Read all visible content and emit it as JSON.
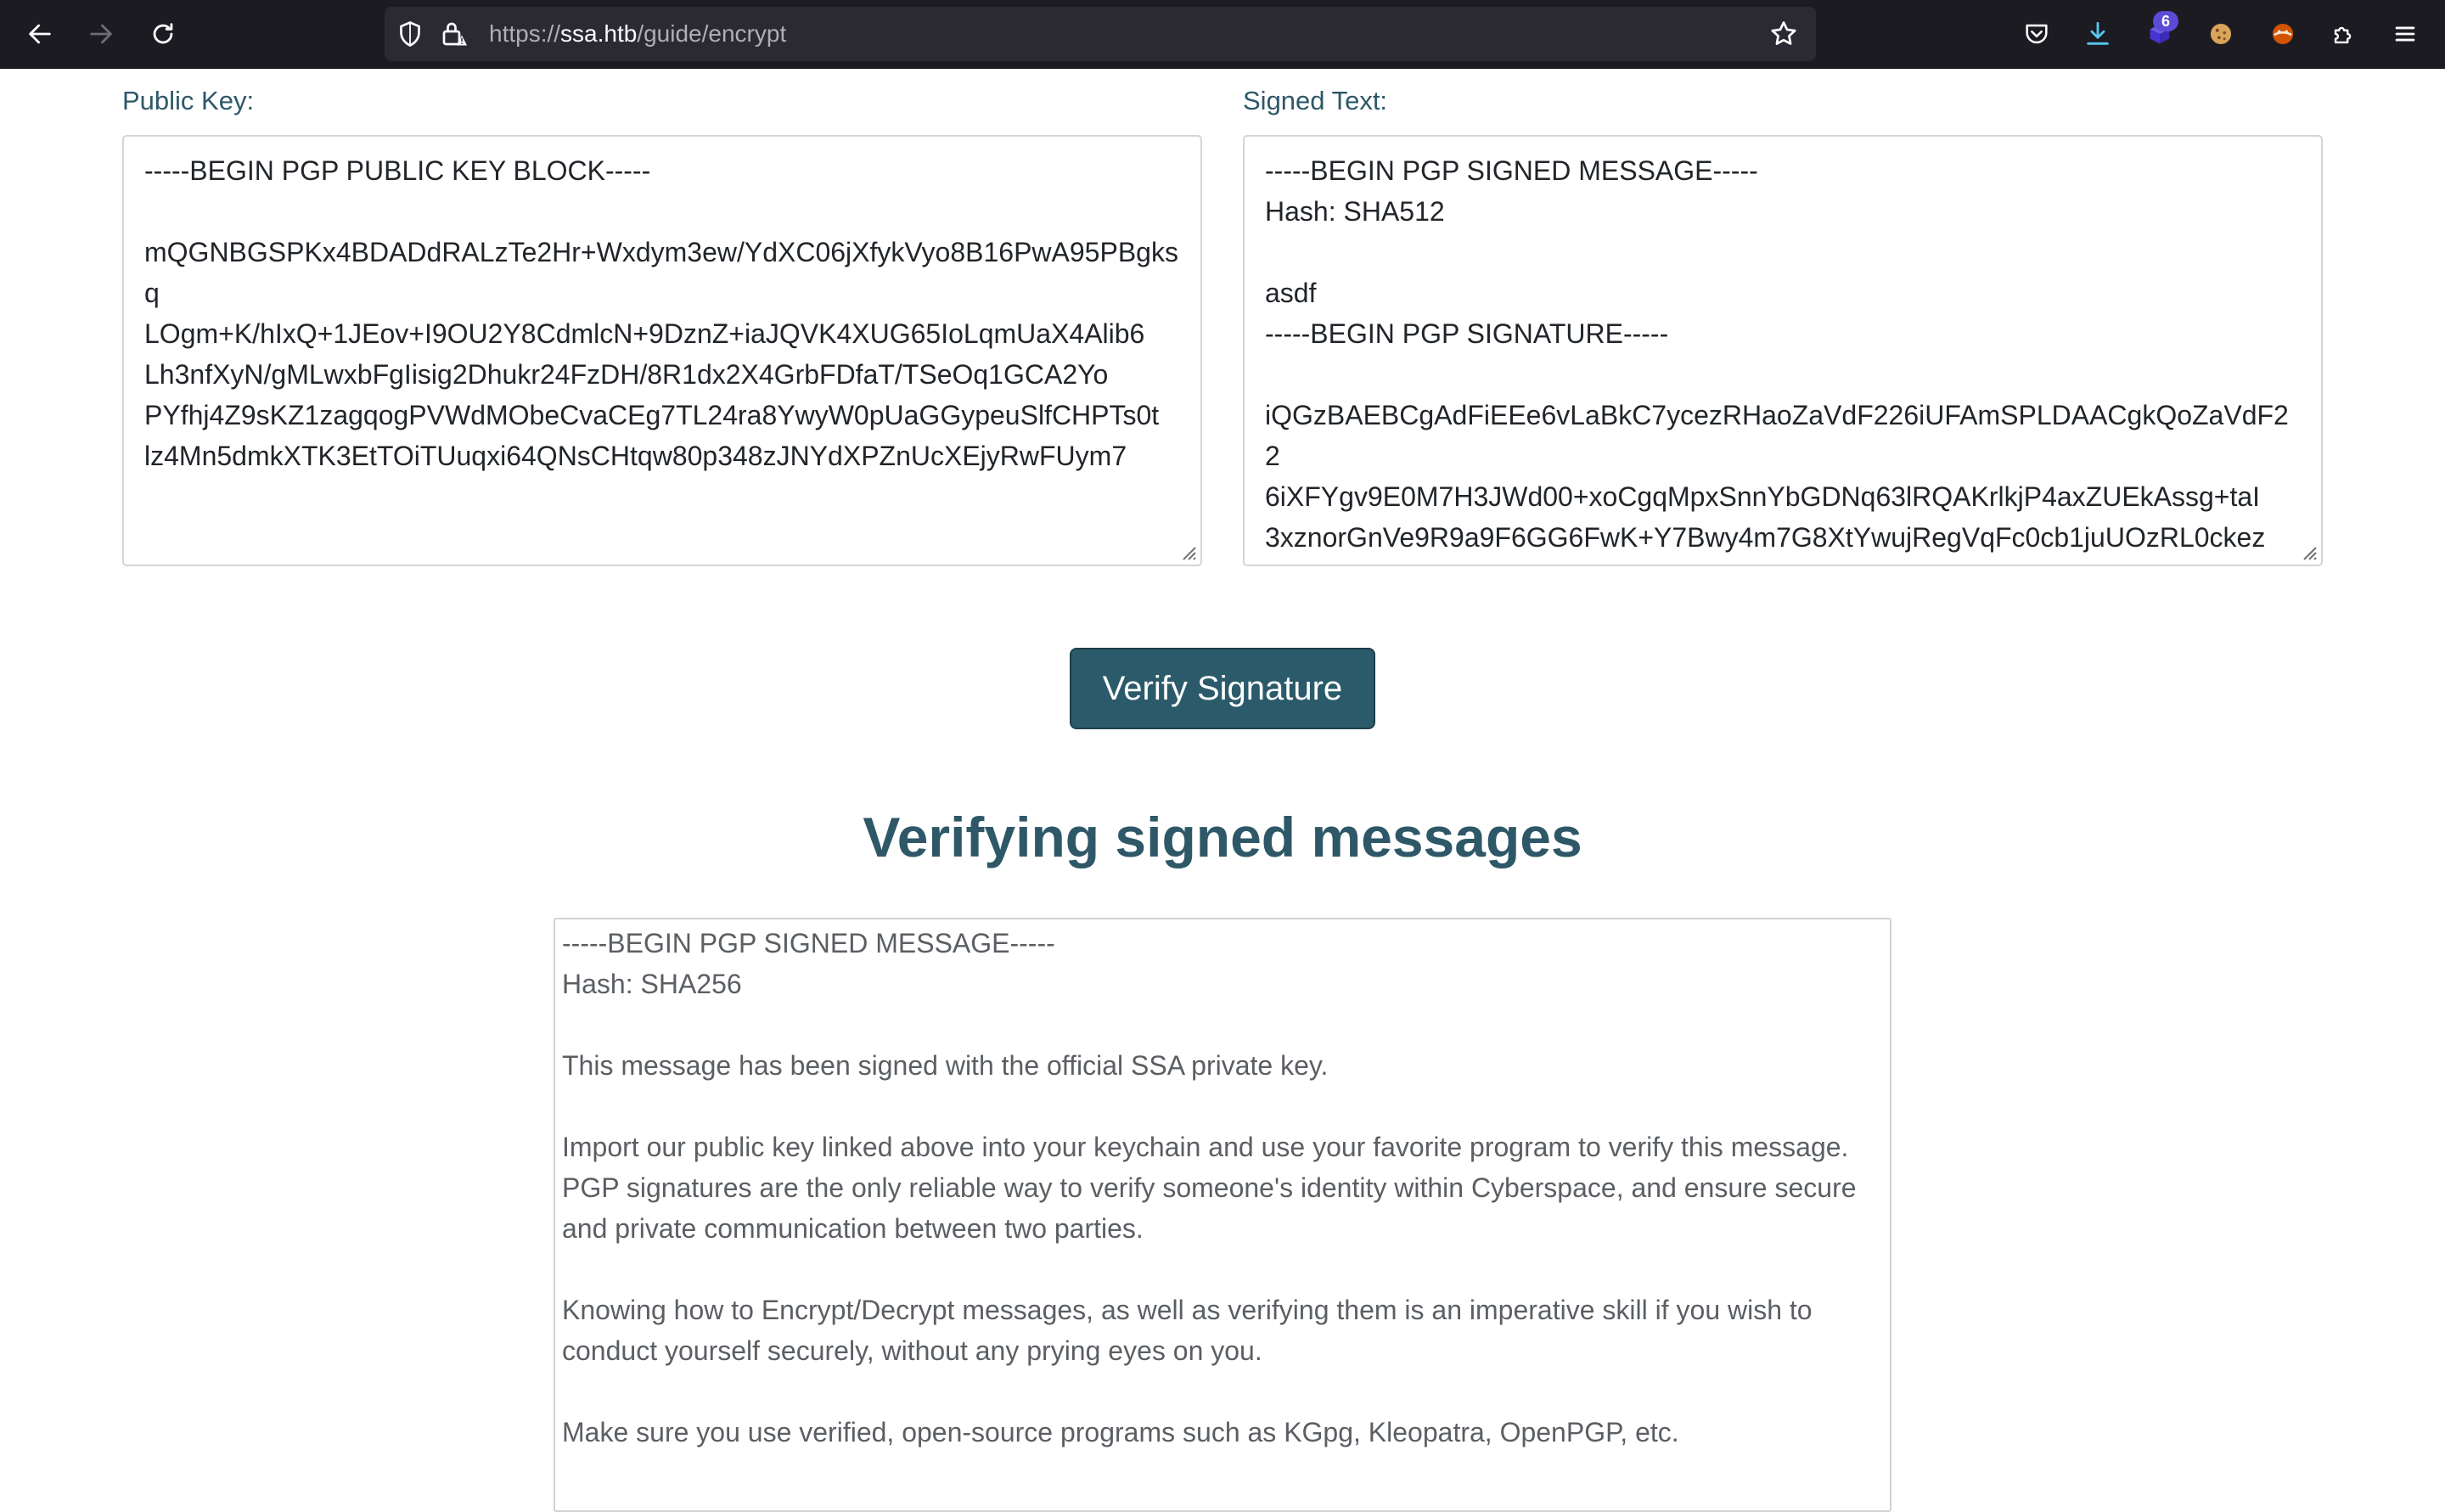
{
  "browser": {
    "url_prefix": "https://",
    "url_host": "ssa.htb",
    "url_path": "/guide/encrypt",
    "extension_badge": "6"
  },
  "verify_form": {
    "public_key_label": "Public Key:",
    "public_key_value": "-----BEGIN PGP PUBLIC KEY BLOCK-----\n\nmQGNBGSPKx4BDADdRALzTe2Hr+Wxdym3ew/YdXC06jXfykVyo8B16PwA95PBgksq\nLOgm+K/hIxQ+1JEov+I9OU2Y8CdmlcN+9DznZ+iaJQVK4XUG65IoLqmUaX4Alib6\nLh3nfXyN/gMLwxbFgIisig2Dhukr24FzDH/8R1dx2X4GrbFDfaT/TSeOq1GCA2Yo\nPYfhj4Z9sKZ1zagqogPVWdMObeCvaCEg7TL24ra8YwyW0pUaGGypeuSlfCHPTs0t\nlz4Mn5dmkXTK3EtTOiTUuqxi64QNsCHtqw80p348zJNYdXPZnUcXEjyRwFUym7",
    "signed_text_label": "Signed Text:",
    "signed_text_value": "-----BEGIN PGP SIGNED MESSAGE-----\nHash: SHA512\n\nasdf\n-----BEGIN PGP SIGNATURE-----\n\niQGzBAEBCgAdFiEEe6vLaBkC7ycezRHaoZaVdF226iUFAmSPLDAACgkQoZaVdF22\n6iXFYgv9E0M7H3JWd00+xoCgqMpxSnnYbGDNq63lRQAKrlkjP4axZUEkAssg+taI\n3xznorGnVe9R9a9F6GG6FwK+Y7Bwy4m7G8XtYwujRegVqFc0cb1juUOzRL0ckez",
    "verify_button_label": "Verify Signature"
  },
  "section": {
    "title": "Verifying signed messages"
  },
  "example_message": "-----BEGIN PGP SIGNED MESSAGE-----\nHash: SHA256\n\nThis message has been signed with the official SSA private key.\n\nImport our public key linked above into your keychain and use your favorite program to verify this message. PGP signatures are the only reliable way to verify someone's identity within Cyberspace, and ensure secure and private communication between two parties.\n\nKnowing how to Encrypt/Decrypt messages, as well as verifying them is an imperative skill if you wish to conduct yourself securely, without any prying eyes on you.\n\nMake sure you use verified, open-source programs such as KGpg, Kleopatra, OpenPGP, etc.",
  "icons": {
    "back": "arrow-left-icon",
    "forward": "arrow-right-icon",
    "reload": "reload-icon",
    "tracking": "shield-icon",
    "lock": "lock-warning-icon",
    "bookmark": "star-icon",
    "pocket": "pocket-icon",
    "downloads": "download-icon",
    "extensions": "puzzle-icon",
    "menu": "hamburger-icon"
  },
  "colors": {
    "toolbar_bg": "#1c1b22",
    "urlbar_bg": "#2b2a33",
    "heading": "#2e5868",
    "button_bg": "#2b5b6a",
    "downloads_accent": "#54c7ec"
  }
}
